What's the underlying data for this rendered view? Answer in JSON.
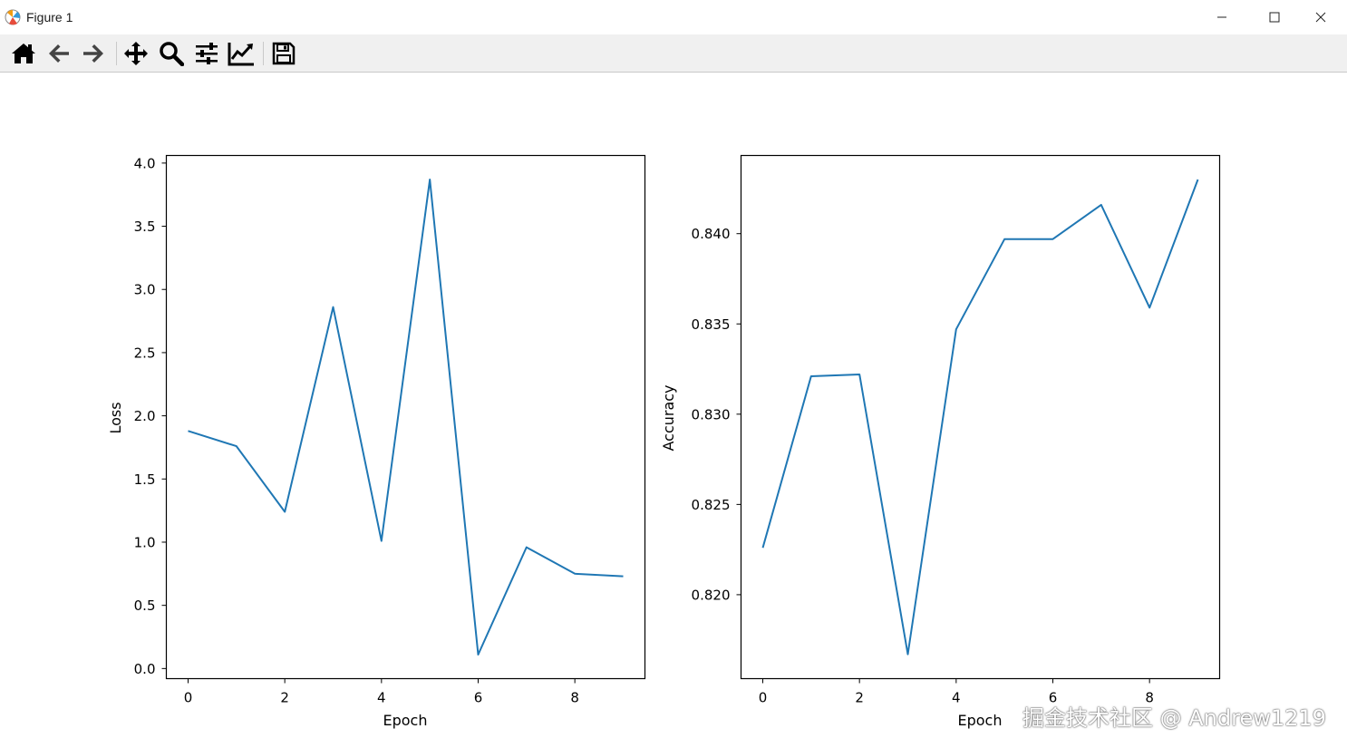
{
  "window": {
    "title": "Figure 1"
  },
  "toolbar": {
    "buttons": [
      {
        "name": "home-icon"
      },
      {
        "name": "back-arrow-icon"
      },
      {
        "name": "forward-arrow-icon"
      },
      {
        "name": "pan-icon"
      },
      {
        "name": "zoom-icon"
      },
      {
        "name": "configure-subplots-icon"
      },
      {
        "name": "edit-axis-icon"
      },
      {
        "name": "save-icon"
      }
    ]
  },
  "colors": {
    "line": "#1f77b4",
    "toolbar_bg": "#f0f0f0"
  },
  "chart_data": [
    {
      "type": "line",
      "xlabel": "Epoch",
      "ylabel": "Loss",
      "x": [
        0,
        1,
        2,
        3,
        4,
        5,
        6,
        7,
        8,
        9
      ],
      "values": [
        1.88,
        1.76,
        1.24,
        2.86,
        1.01,
        3.87,
        0.11,
        0.96,
        0.75,
        0.73
      ],
      "xlim": [
        -0.45,
        9.45
      ],
      "ylim": [
        -0.08,
        4.06
      ],
      "xticks": [
        0,
        2,
        4,
        6,
        8
      ],
      "xtick_labels": [
        "0",
        "2",
        "4",
        "6",
        "8"
      ],
      "yticks": [
        0.0,
        0.5,
        1.0,
        1.5,
        2.0,
        2.5,
        3.0,
        3.5,
        4.0
      ],
      "ytick_labels": [
        "0.0",
        "0.5",
        "1.0",
        "1.5",
        "2.0",
        "2.5",
        "3.0",
        "3.5",
        "4.0"
      ],
      "grid": false
    },
    {
      "type": "line",
      "xlabel": "Epoch",
      "ylabel": "Accuracy",
      "x": [
        0,
        1,
        2,
        3,
        4,
        5,
        6,
        7,
        8,
        9
      ],
      "values": [
        0.8226,
        0.8321,
        0.8322,
        0.8167,
        0.8347,
        0.8397,
        0.8397,
        0.8416,
        0.8359,
        0.843
      ],
      "xlim": [
        -0.45,
        9.45
      ],
      "ylim": [
        0.81535,
        0.84433
      ],
      "xticks": [
        0,
        2,
        4,
        6,
        8
      ],
      "xtick_labels": [
        "0",
        "2",
        "4",
        "6",
        "8"
      ],
      "yticks": [
        0.82,
        0.825,
        0.83,
        0.835,
        0.84
      ],
      "ytick_labels": [
        "0.820",
        "0.825",
        "0.830",
        "0.835",
        "0.840"
      ],
      "grid": false
    }
  ],
  "watermark": {
    "text": "掘金技术社区 @ Andrew1219"
  }
}
